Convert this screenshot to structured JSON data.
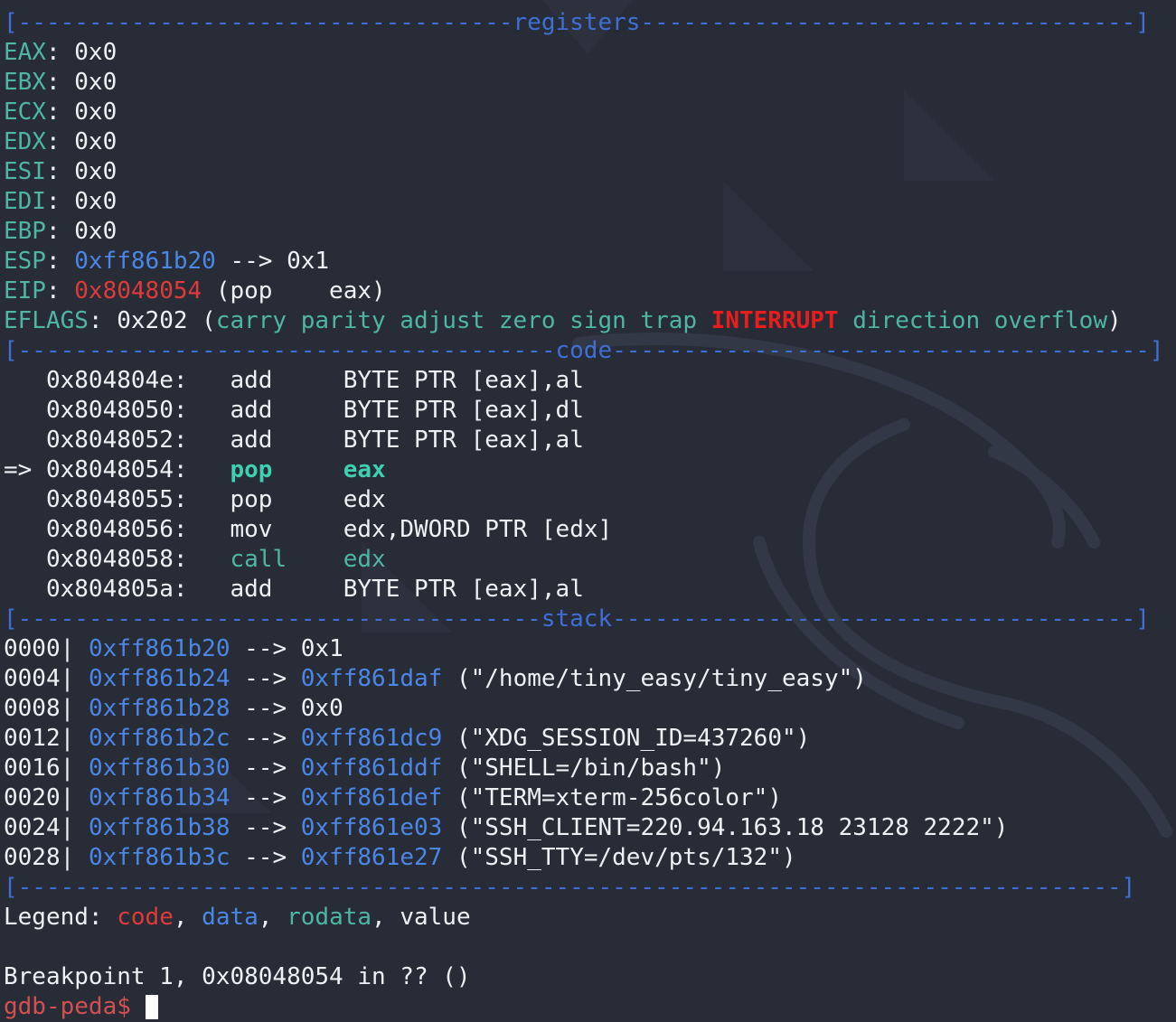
{
  "separators": {
    "registers": "[-----------------------------------registers-----------------------------------]",
    "code": "[--------------------------------------code--------------------------------------]",
    "stack": "[-------------------------------------stack-------------------------------------]",
    "end": "[------------------------------------------------------------------------------]"
  },
  "registers": [
    {
      "name": "EAX",
      "sep": ": ",
      "value": "0x0"
    },
    {
      "name": "EBX",
      "sep": ": ",
      "value": "0x0"
    },
    {
      "name": "ECX",
      "sep": ": ",
      "value": "0x0"
    },
    {
      "name": "EDX",
      "sep": ": ",
      "value": "0x0"
    },
    {
      "name": "ESI",
      "sep": ": ",
      "value": "0x0"
    },
    {
      "name": "EDI",
      "sep": ": ",
      "value": "0x0"
    },
    {
      "name": "EBP",
      "sep": ": ",
      "value": "0x0"
    }
  ],
  "esp": {
    "name": "ESP",
    "sep": ": ",
    "addr": "0xff861b20",
    "arrow": " --> ",
    "value": "0x1"
  },
  "eip": {
    "name": "EIP",
    "sep": ": ",
    "addr": "0x8048054",
    "rest": " (pop    eax)"
  },
  "eflags": {
    "name": "EFLAGS",
    "value": ": 0x202 (",
    "flags_before": "carry parity adjust zero sign trap ",
    "flag_set": "INTERRUPT",
    "flags_after": " direction overflow",
    "close": ")"
  },
  "code": [
    {
      "prefix": "   ",
      "addr": "0x804804e:",
      "op": "add ",
      "args": "BYTE PTR [eax],al",
      "style": "normal"
    },
    {
      "prefix": "   ",
      "addr": "0x8048050:",
      "op": "add ",
      "args": "BYTE PTR [eax],dl",
      "style": "normal"
    },
    {
      "prefix": "   ",
      "addr": "0x8048052:",
      "op": "add ",
      "args": "BYTE PTR [eax],al",
      "style": "normal"
    },
    {
      "prefix": "=> ",
      "addr": "0x8048054:",
      "op": "pop ",
      "args": "eax",
      "style": "current"
    },
    {
      "prefix": "   ",
      "addr": "0x8048055:",
      "op": "pop ",
      "args": "edx",
      "style": "normal"
    },
    {
      "prefix": "   ",
      "addr": "0x8048056:",
      "op": "mov ",
      "args": "edx,DWORD PTR [edx]",
      "style": "normal"
    },
    {
      "prefix": "   ",
      "addr": "0x8048058:",
      "op": "call",
      "args": "edx",
      "style": "call"
    },
    {
      "prefix": "   ",
      "addr": "0x804805a:",
      "op": "add ",
      "args": "BYTE PTR [eax],al",
      "style": "normal"
    }
  ],
  "stack": [
    {
      "off": "0000",
      "addr": "0xff861b20",
      "arrow": " --> ",
      "ptr": "",
      "value": "0x1"
    },
    {
      "off": "0004",
      "addr": "0xff861b24",
      "arrow": " --> ",
      "ptr": "0xff861daf",
      "value": " (\"/home/tiny_easy/tiny_easy\")"
    },
    {
      "off": "0008",
      "addr": "0xff861b28",
      "arrow": " --> ",
      "ptr": "",
      "value": "0x0"
    },
    {
      "off": "0012",
      "addr": "0xff861b2c",
      "arrow": " --> ",
      "ptr": "0xff861dc9",
      "value": " (\"XDG_SESSION_ID=437260\")"
    },
    {
      "off": "0016",
      "addr": "0xff861b30",
      "arrow": " --> ",
      "ptr": "0xff861ddf",
      "value": " (\"SHELL=/bin/bash\")"
    },
    {
      "off": "0020",
      "addr": "0xff861b34",
      "arrow": " --> ",
      "ptr": "0xff861def",
      "value": " (\"TERM=xterm-256color\")"
    },
    {
      "off": "0024",
      "addr": "0xff861b38",
      "arrow": " --> ",
      "ptr": "0xff861e03",
      "value": " (\"SSH_CLIENT=220.94.163.18 23128 2222\")"
    },
    {
      "off": "0028",
      "addr": "0xff861b3c",
      "arrow": " --> ",
      "ptr": "0xff861e27",
      "value": " (\"SSH_TTY=/dev/pts/132\")"
    }
  ],
  "legend": {
    "label": "Legend: ",
    "code": "code",
    "data": "data",
    "rodata": "rodata",
    "value": "value"
  },
  "breakpoint": "Breakpoint 1, 0x08048054 in ?? ()",
  "prompt": "gdb-peda$ "
}
